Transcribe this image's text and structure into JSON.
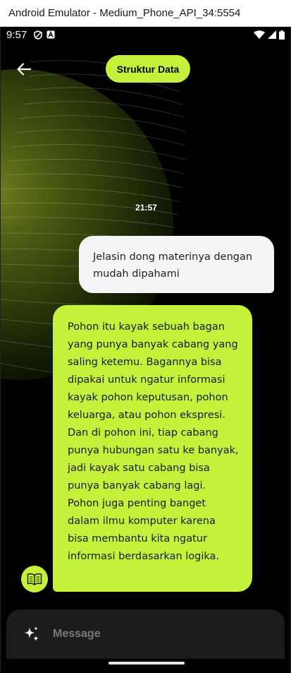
{
  "window": {
    "title": "Android Emulator - Medium_Phone_API_34:5554"
  },
  "status_bar": {
    "time": "9:57",
    "icons": [
      "shield-icon",
      "a-badge-icon",
      "wifi-icon",
      "signal-icon",
      "battery-icon"
    ]
  },
  "header": {
    "back_icon": "arrow-left-icon",
    "topic": "Struktur Data"
  },
  "chat": {
    "timestamp": "21:57",
    "messages": [
      {
        "role": "user",
        "text": "Jelasin dong materinya dengan mudah dipahami"
      },
      {
        "role": "assistant",
        "text": "Pohon itu kayak sebuah bagan yang punya banyak cabang yang saling ketemu. Bagannya bisa dipakai untuk ngatur informasi kayak pohon keputusan, pohon keluarga, atau pohon ekspresi. Dan di pohon ini, tiap cabang punya hubungan satu ke banyak, jadi kayak satu cabang bisa punya banyak cabang lagi. Pohon juga penting banget dalam ilmu komputer karena bisa membantu kita ngatur informasi berdasarkan logika."
      }
    ],
    "assistant_avatar_icon": "book-icon"
  },
  "composer": {
    "placeholder": "Message",
    "value": "",
    "sparkle_icon": "sparkle-icon"
  },
  "colors": {
    "accent": "#c5f13a",
    "background": "#000000",
    "user_bubble": "#f4f4f6",
    "composer": "#1c1c1e"
  }
}
